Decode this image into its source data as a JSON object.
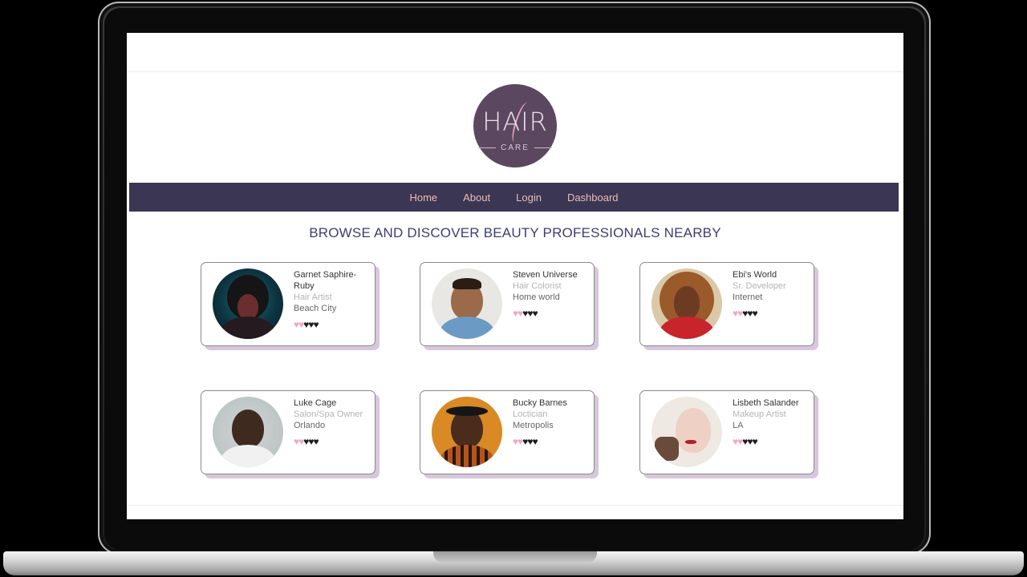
{
  "logo": {
    "main": "HAIR",
    "sub": "CARE"
  },
  "nav": {
    "items": [
      "Home",
      "About",
      "Login",
      "Dashboard"
    ]
  },
  "heading": "BROWSE AND DISCOVER BEAUTY PROFESSIONALS NEARBY",
  "colors": {
    "nav_bg": "#3b3653",
    "nav_text": "#eabdb6",
    "heading": "#3d3d73",
    "heart_active": "#f2a9bd",
    "heart_inactive": "#1b1b1b",
    "card_shadow": "#d7c6dc"
  },
  "rating_max": 5,
  "professionals": [
    {
      "name": "Garnet Saphire-Ruby",
      "role": "Hair Artist",
      "location": "Beach City",
      "rating": 2
    },
    {
      "name": "Steven Universe",
      "role": "Hair Colorist",
      "location": "Home world",
      "rating": 2
    },
    {
      "name": "Ebi's World",
      "role": "Sr. Developer",
      "location": "Internet",
      "rating": 2
    },
    {
      "name": "Luke Cage",
      "role": "Salon/Spa Owner",
      "location": "Orlando",
      "rating": 2
    },
    {
      "name": "Bucky Barnes",
      "role": "Loctician",
      "location": "Metropolis",
      "rating": 2
    },
    {
      "name": "Lisbeth Salander",
      "role": "Makeup Artist",
      "location": "LA",
      "rating": 2
    }
  ]
}
